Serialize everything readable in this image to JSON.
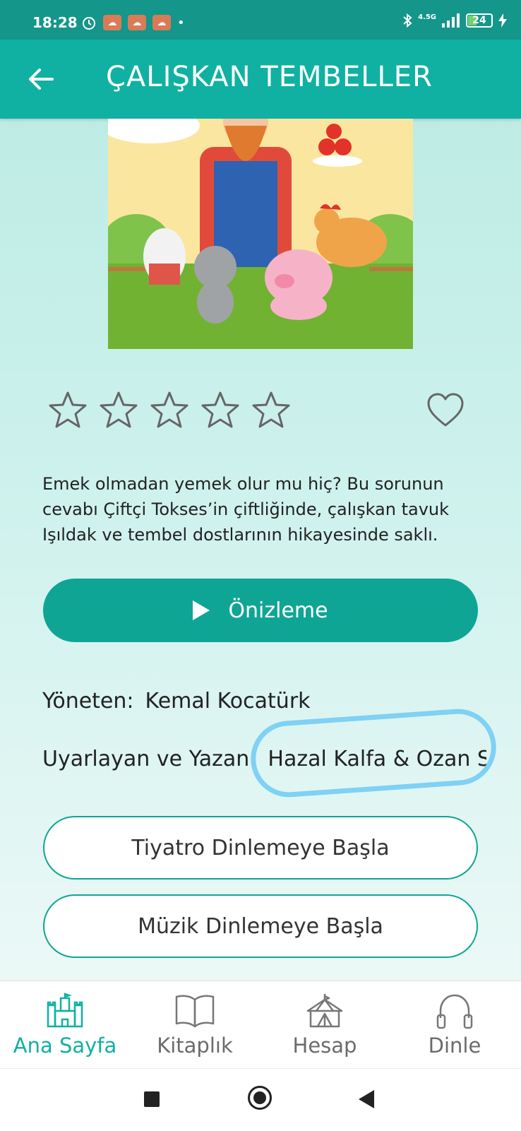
{
  "status_bar": {
    "time": "18:28",
    "network": "4.5G",
    "battery": "24"
  },
  "app_bar": {
    "title": "ÇALIŞKAN TEMBELLER"
  },
  "rating": {
    "stars_filled": 0,
    "stars_total": 5
  },
  "description": "Emek olmadan yemek olur mu hiç? Bu sorunun cevabı Çiftçi Tokses’in çiftliğinde, çalışkan tavuk Işıldak ve tembel dostlarının hikayesinde saklı.",
  "preview_button": {
    "label": "Önizleme"
  },
  "credits": {
    "director_label": "Yöneten:",
    "director_value": "Kemal Kocatürk",
    "writer_label": "Uyarlayan ve Yazan:",
    "writer_value": "Hazal Kalfa & Ozan S"
  },
  "actions": {
    "theatre_label": "Tiyatro Dinlemeye Başla",
    "music_label": "Müzik Dinlemeye Başla"
  },
  "tabs": [
    {
      "label": "Ana Sayfa",
      "icon": "castle-icon",
      "active": true
    },
    {
      "label": "Kitaplık",
      "icon": "book-icon",
      "active": false
    },
    {
      "label": "Hesap",
      "icon": "circus-tent-icon",
      "active": false
    },
    {
      "label": "Dinle",
      "icon": "headphones-icon",
      "active": false
    }
  ],
  "colors": {
    "primary": "#10b1a2",
    "status_bar": "#14968a",
    "button": "#0fa595",
    "highlight": "#7fd1f5"
  }
}
